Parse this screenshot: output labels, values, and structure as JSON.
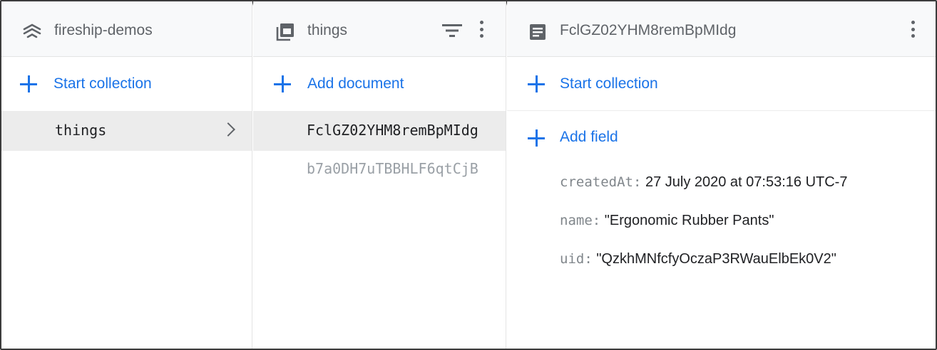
{
  "panels": {
    "root": {
      "title": "fireship-demos",
      "icon": "firestore-stack-icon",
      "add_label": "Start collection",
      "items": [
        {
          "label": "things",
          "selected": true
        }
      ]
    },
    "collection": {
      "title": "things",
      "icon": "collection-icon",
      "add_label": "Add document",
      "items": [
        {
          "label": "FclGZ02YHM8remBpMIdg",
          "selected": true
        },
        {
          "label": "b7a0DH7uTBBHLF6qtCjB",
          "selected": false
        }
      ]
    },
    "document": {
      "title": "FclGZ02YHM8remBpMIdg",
      "icon": "document-icon",
      "start_collection_label": "Start collection",
      "add_field_label": "Add field",
      "fields": [
        {
          "key": "createdAt:",
          "value": "27 July 2020 at 07:53:16 UTC-7"
        },
        {
          "key": "name:",
          "value": "\"Ergonomic Rubber Pants\""
        },
        {
          "key": "uid:",
          "value": "\"QzkhMNfcfyOczaP3RWauElbEk0V2\""
        }
      ]
    }
  },
  "colors": {
    "accent": "#1a73e8",
    "header_bg": "#f8f9fa",
    "selected_bg": "#ececec",
    "muted_text": "#5f6368"
  }
}
